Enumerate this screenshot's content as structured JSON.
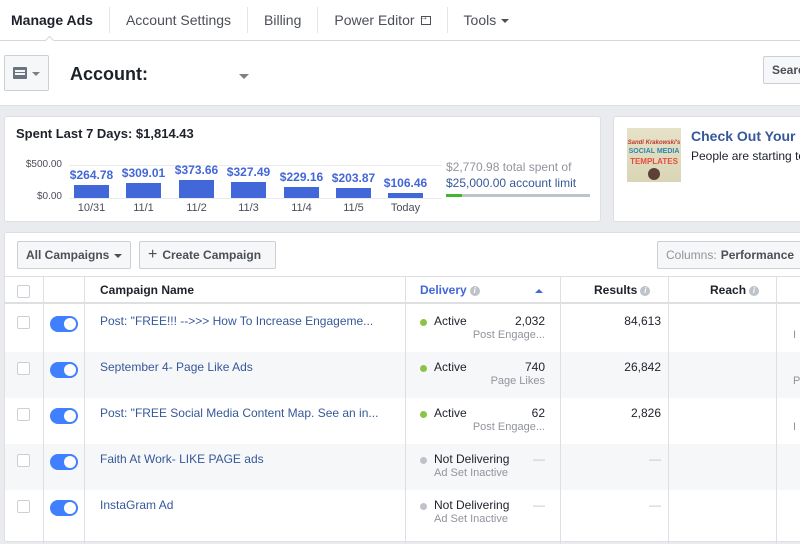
{
  "nav": {
    "items": [
      {
        "label": "Manage Ads",
        "active": true
      },
      {
        "label": "Account Settings"
      },
      {
        "label": "Billing"
      },
      {
        "label": "Power Editor"
      },
      {
        "label": "Tools"
      }
    ]
  },
  "account": {
    "label": "Account:",
    "search_label": "Search"
  },
  "spend": {
    "title": "Spent Last 7 Days: $1,814.43",
    "total_spent": "$2,770.98 total spent of",
    "account_limit": "$25,000.00 account limit",
    "limit_progress": 0.111
  },
  "chart_data": {
    "type": "bar",
    "title": "Spent Last 7 Days: $1,814.43",
    "categories": [
      "10/31",
      "11/1",
      "11/2",
      "11/3",
      "11/4",
      "11/5",
      "Today"
    ],
    "values": [
      264.78,
      309.01,
      373.66,
      327.49,
      229.16,
      203.87,
      106.46
    ],
    "data_labels": [
      "$264.78",
      "$309.01",
      "$373.66",
      "$327.49",
      "$229.16",
      "$203.87",
      "$106.46"
    ],
    "y_ticks": [
      "$500.00",
      "$0.00"
    ],
    "ylim": [
      0,
      500
    ],
    "xlabel": "",
    "ylabel": "",
    "color": "#4267d8"
  },
  "promo": {
    "title": "Check Out Your",
    "text": "People are starting to",
    "image_lines": [
      "Sandi Krakowski's",
      "SOCIAL MEDIA",
      "TEMPLATES"
    ]
  },
  "campaigns": {
    "filter_label": "All Campaigns",
    "create_label": "Create Campaign",
    "columns_label": "Columns:",
    "columns_value": "Performance",
    "headers": {
      "name": "Campaign Name",
      "delivery": "Delivery",
      "results": "Results",
      "reach": "Reach"
    },
    "rows": [
      {
        "name": "Post: \"FREE!!! -->>> How To Increase Engageme...",
        "delivery": "Active",
        "delivery_sub": "",
        "status_color": "#8bc34a",
        "results": "2,032",
        "results_sub": "Post Engage...",
        "reach": "84,613",
        "edge_sub": "I"
      },
      {
        "name": "September 4- Page Like Ads",
        "delivery": "Active",
        "delivery_sub": "",
        "status_color": "#8bc34a",
        "results": "740",
        "results_sub": "Page Likes",
        "reach": "26,842",
        "edge_sub": "P"
      },
      {
        "name": "Post: \"FREE Social Media Content Map. See an in...",
        "delivery": "Active",
        "delivery_sub": "",
        "status_color": "#8bc34a",
        "results": "62",
        "results_sub": "Post Engage...",
        "reach": "2,826",
        "edge_sub": "I"
      },
      {
        "name": "Faith At Work- LIKE PAGE ads",
        "delivery": "Not Delivering",
        "delivery_sub": "Ad Set Inactive",
        "status_color": "#bec2c9",
        "results": "—",
        "results_sub": "",
        "reach": "—",
        "edge_sub": ""
      },
      {
        "name": "InstaGram Ad",
        "delivery": "Not Delivering",
        "delivery_sub": "Ad Set Inactive",
        "status_color": "#bec2c9",
        "results": "—",
        "results_sub": "",
        "reach": "—",
        "edge_sub": ""
      }
    ]
  }
}
